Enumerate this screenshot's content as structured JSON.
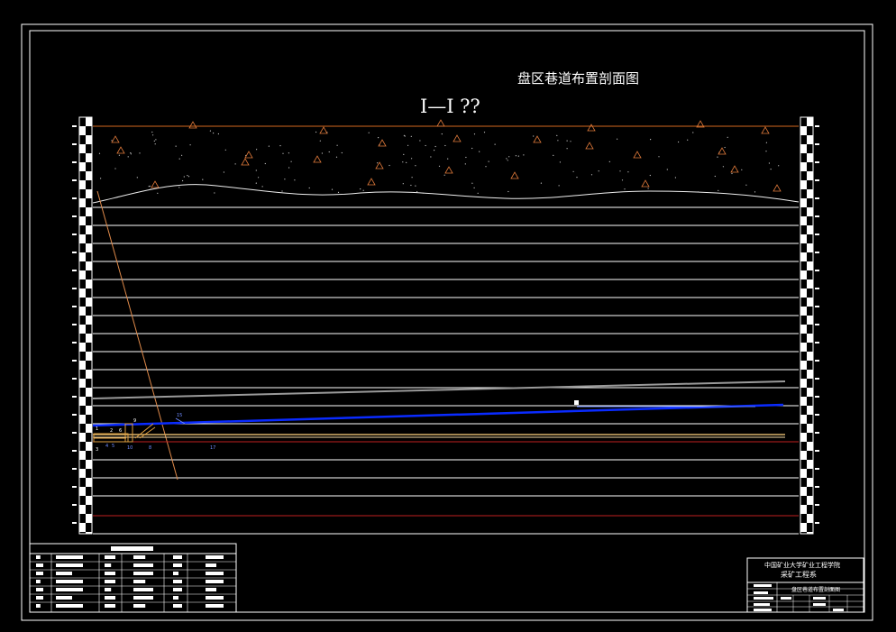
{
  "drawing": {
    "title": "盘区巷道布置剖面图",
    "section_title": "I—I ??"
  },
  "title_block": {
    "school": "中国矿业大学矿业工程学院",
    "department": "采矿工程系",
    "drawing_name": "盘区巷道布置剖面图"
  },
  "callouts": [
    "1",
    "2",
    "3",
    "4",
    "5",
    "6",
    "8",
    "9",
    "10",
    "15",
    "17"
  ],
  "colors": {
    "background": "#000000",
    "frame": "#ffffff",
    "topsoil_outline": "#d2691e",
    "fault_line": "#e08a4a",
    "roadway_blue": "#0a2bff",
    "roadway_gray": "#9a9a9a",
    "seam_yellow": "#d9b36a",
    "seam_red": "#c02020"
  }
}
